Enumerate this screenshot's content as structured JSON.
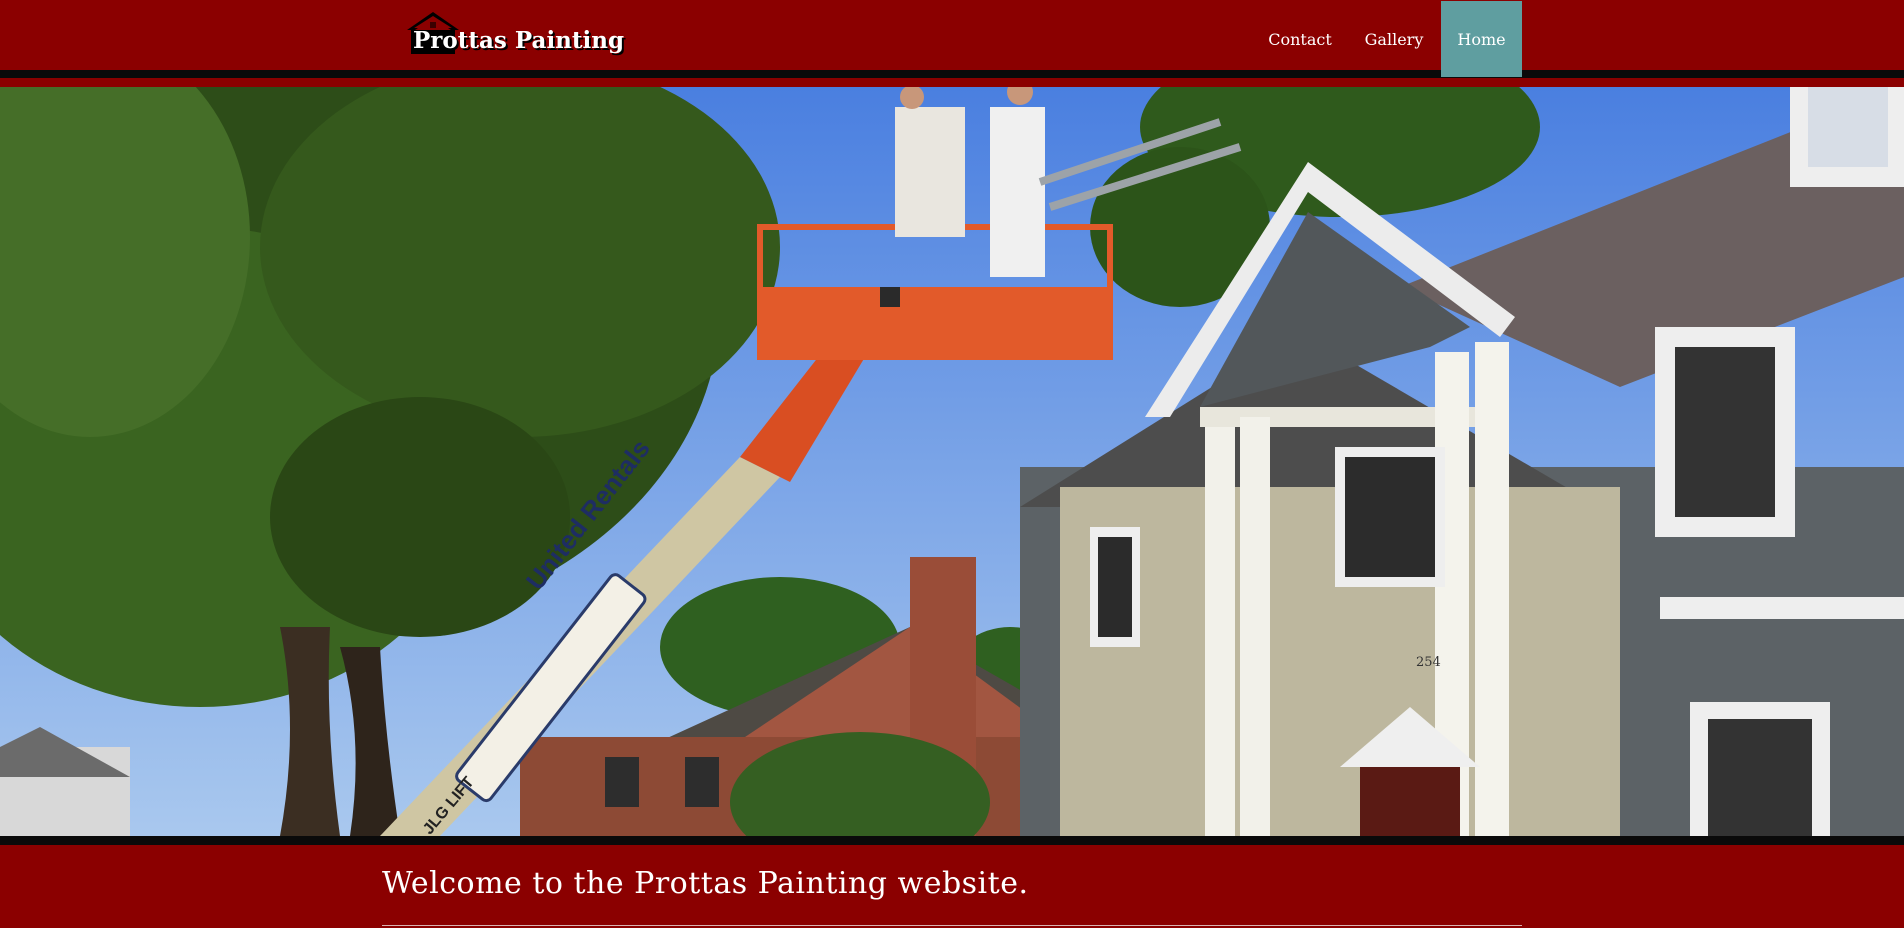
{
  "header": {
    "logo_text": "Prottas Painting",
    "nav": [
      {
        "label": "Contact"
      },
      {
        "label": "Gallery"
      },
      {
        "label": "Home",
        "active": true
      }
    ]
  },
  "hero": {
    "lift_brand_text": "United Rentals",
    "lift_model_text": "JLG LIFT",
    "house_number": "254"
  },
  "main": {
    "welcome_heading": "Welcome to the Prottas Painting website."
  },
  "colors": {
    "header_bg": "#8b0000",
    "active_tab": "#5f9ea0",
    "text": "#ffffff"
  }
}
